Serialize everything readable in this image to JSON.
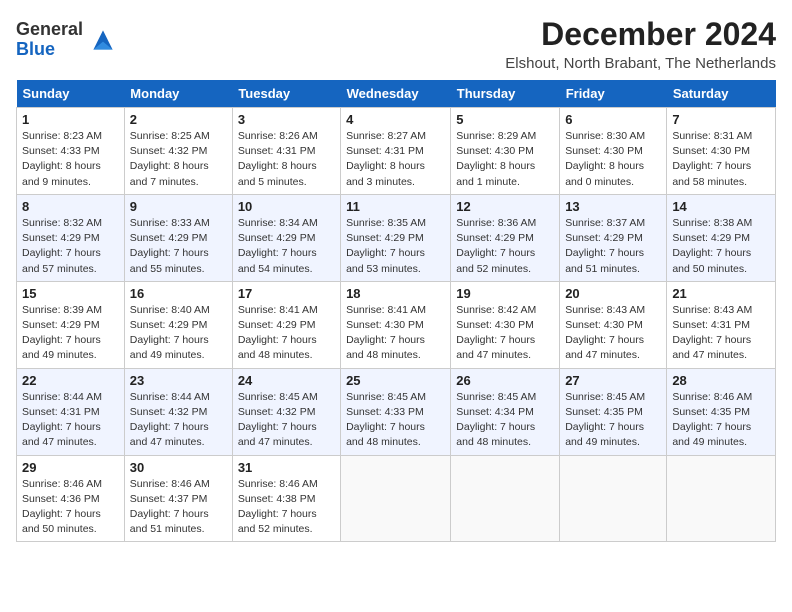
{
  "header": {
    "logo_general": "General",
    "logo_blue": "Blue",
    "month_year": "December 2024",
    "location": "Elshout, North Brabant, The Netherlands"
  },
  "weekdays": [
    "Sunday",
    "Monday",
    "Tuesday",
    "Wednesday",
    "Thursday",
    "Friday",
    "Saturday"
  ],
  "weeks": [
    [
      {
        "day": "1",
        "sunrise": "Sunrise: 8:23 AM",
        "sunset": "Sunset: 4:33 PM",
        "daylight": "Daylight: 8 hours and 9 minutes."
      },
      {
        "day": "2",
        "sunrise": "Sunrise: 8:25 AM",
        "sunset": "Sunset: 4:32 PM",
        "daylight": "Daylight: 8 hours and 7 minutes."
      },
      {
        "day": "3",
        "sunrise": "Sunrise: 8:26 AM",
        "sunset": "Sunset: 4:31 PM",
        "daylight": "Daylight: 8 hours and 5 minutes."
      },
      {
        "day": "4",
        "sunrise": "Sunrise: 8:27 AM",
        "sunset": "Sunset: 4:31 PM",
        "daylight": "Daylight: 8 hours and 3 minutes."
      },
      {
        "day": "5",
        "sunrise": "Sunrise: 8:29 AM",
        "sunset": "Sunset: 4:30 PM",
        "daylight": "Daylight: 8 hours and 1 minute."
      },
      {
        "day": "6",
        "sunrise": "Sunrise: 8:30 AM",
        "sunset": "Sunset: 4:30 PM",
        "daylight": "Daylight: 8 hours and 0 minutes."
      },
      {
        "day": "7",
        "sunrise": "Sunrise: 8:31 AM",
        "sunset": "Sunset: 4:30 PM",
        "daylight": "Daylight: 7 hours and 58 minutes."
      }
    ],
    [
      {
        "day": "8",
        "sunrise": "Sunrise: 8:32 AM",
        "sunset": "Sunset: 4:29 PM",
        "daylight": "Daylight: 7 hours and 57 minutes."
      },
      {
        "day": "9",
        "sunrise": "Sunrise: 8:33 AM",
        "sunset": "Sunset: 4:29 PM",
        "daylight": "Daylight: 7 hours and 55 minutes."
      },
      {
        "day": "10",
        "sunrise": "Sunrise: 8:34 AM",
        "sunset": "Sunset: 4:29 PM",
        "daylight": "Daylight: 7 hours and 54 minutes."
      },
      {
        "day": "11",
        "sunrise": "Sunrise: 8:35 AM",
        "sunset": "Sunset: 4:29 PM",
        "daylight": "Daylight: 7 hours and 53 minutes."
      },
      {
        "day": "12",
        "sunrise": "Sunrise: 8:36 AM",
        "sunset": "Sunset: 4:29 PM",
        "daylight": "Daylight: 7 hours and 52 minutes."
      },
      {
        "day": "13",
        "sunrise": "Sunrise: 8:37 AM",
        "sunset": "Sunset: 4:29 PM",
        "daylight": "Daylight: 7 hours and 51 minutes."
      },
      {
        "day": "14",
        "sunrise": "Sunrise: 8:38 AM",
        "sunset": "Sunset: 4:29 PM",
        "daylight": "Daylight: 7 hours and 50 minutes."
      }
    ],
    [
      {
        "day": "15",
        "sunrise": "Sunrise: 8:39 AM",
        "sunset": "Sunset: 4:29 PM",
        "daylight": "Daylight: 7 hours and 49 minutes."
      },
      {
        "day": "16",
        "sunrise": "Sunrise: 8:40 AM",
        "sunset": "Sunset: 4:29 PM",
        "daylight": "Daylight: 7 hours and 49 minutes."
      },
      {
        "day": "17",
        "sunrise": "Sunrise: 8:41 AM",
        "sunset": "Sunset: 4:29 PM",
        "daylight": "Daylight: 7 hours and 48 minutes."
      },
      {
        "day": "18",
        "sunrise": "Sunrise: 8:41 AM",
        "sunset": "Sunset: 4:30 PM",
        "daylight": "Daylight: 7 hours and 48 minutes."
      },
      {
        "day": "19",
        "sunrise": "Sunrise: 8:42 AM",
        "sunset": "Sunset: 4:30 PM",
        "daylight": "Daylight: 7 hours and 47 minutes."
      },
      {
        "day": "20",
        "sunrise": "Sunrise: 8:43 AM",
        "sunset": "Sunset: 4:30 PM",
        "daylight": "Daylight: 7 hours and 47 minutes."
      },
      {
        "day": "21",
        "sunrise": "Sunrise: 8:43 AM",
        "sunset": "Sunset: 4:31 PM",
        "daylight": "Daylight: 7 hours and 47 minutes."
      }
    ],
    [
      {
        "day": "22",
        "sunrise": "Sunrise: 8:44 AM",
        "sunset": "Sunset: 4:31 PM",
        "daylight": "Daylight: 7 hours and 47 minutes."
      },
      {
        "day": "23",
        "sunrise": "Sunrise: 8:44 AM",
        "sunset": "Sunset: 4:32 PM",
        "daylight": "Daylight: 7 hours and 47 minutes."
      },
      {
        "day": "24",
        "sunrise": "Sunrise: 8:45 AM",
        "sunset": "Sunset: 4:32 PM",
        "daylight": "Daylight: 7 hours and 47 minutes."
      },
      {
        "day": "25",
        "sunrise": "Sunrise: 8:45 AM",
        "sunset": "Sunset: 4:33 PM",
        "daylight": "Daylight: 7 hours and 48 minutes."
      },
      {
        "day": "26",
        "sunrise": "Sunrise: 8:45 AM",
        "sunset": "Sunset: 4:34 PM",
        "daylight": "Daylight: 7 hours and 48 minutes."
      },
      {
        "day": "27",
        "sunrise": "Sunrise: 8:45 AM",
        "sunset": "Sunset: 4:35 PM",
        "daylight": "Daylight: 7 hours and 49 minutes."
      },
      {
        "day": "28",
        "sunrise": "Sunrise: 8:46 AM",
        "sunset": "Sunset: 4:35 PM",
        "daylight": "Daylight: 7 hours and 49 minutes."
      }
    ],
    [
      {
        "day": "29",
        "sunrise": "Sunrise: 8:46 AM",
        "sunset": "Sunset: 4:36 PM",
        "daylight": "Daylight: 7 hours and 50 minutes."
      },
      {
        "day": "30",
        "sunrise": "Sunrise: 8:46 AM",
        "sunset": "Sunset: 4:37 PM",
        "daylight": "Daylight: 7 hours and 51 minutes."
      },
      {
        "day": "31",
        "sunrise": "Sunrise: 8:46 AM",
        "sunset": "Sunset: 4:38 PM",
        "daylight": "Daylight: 7 hours and 52 minutes."
      },
      null,
      null,
      null,
      null
    ]
  ]
}
